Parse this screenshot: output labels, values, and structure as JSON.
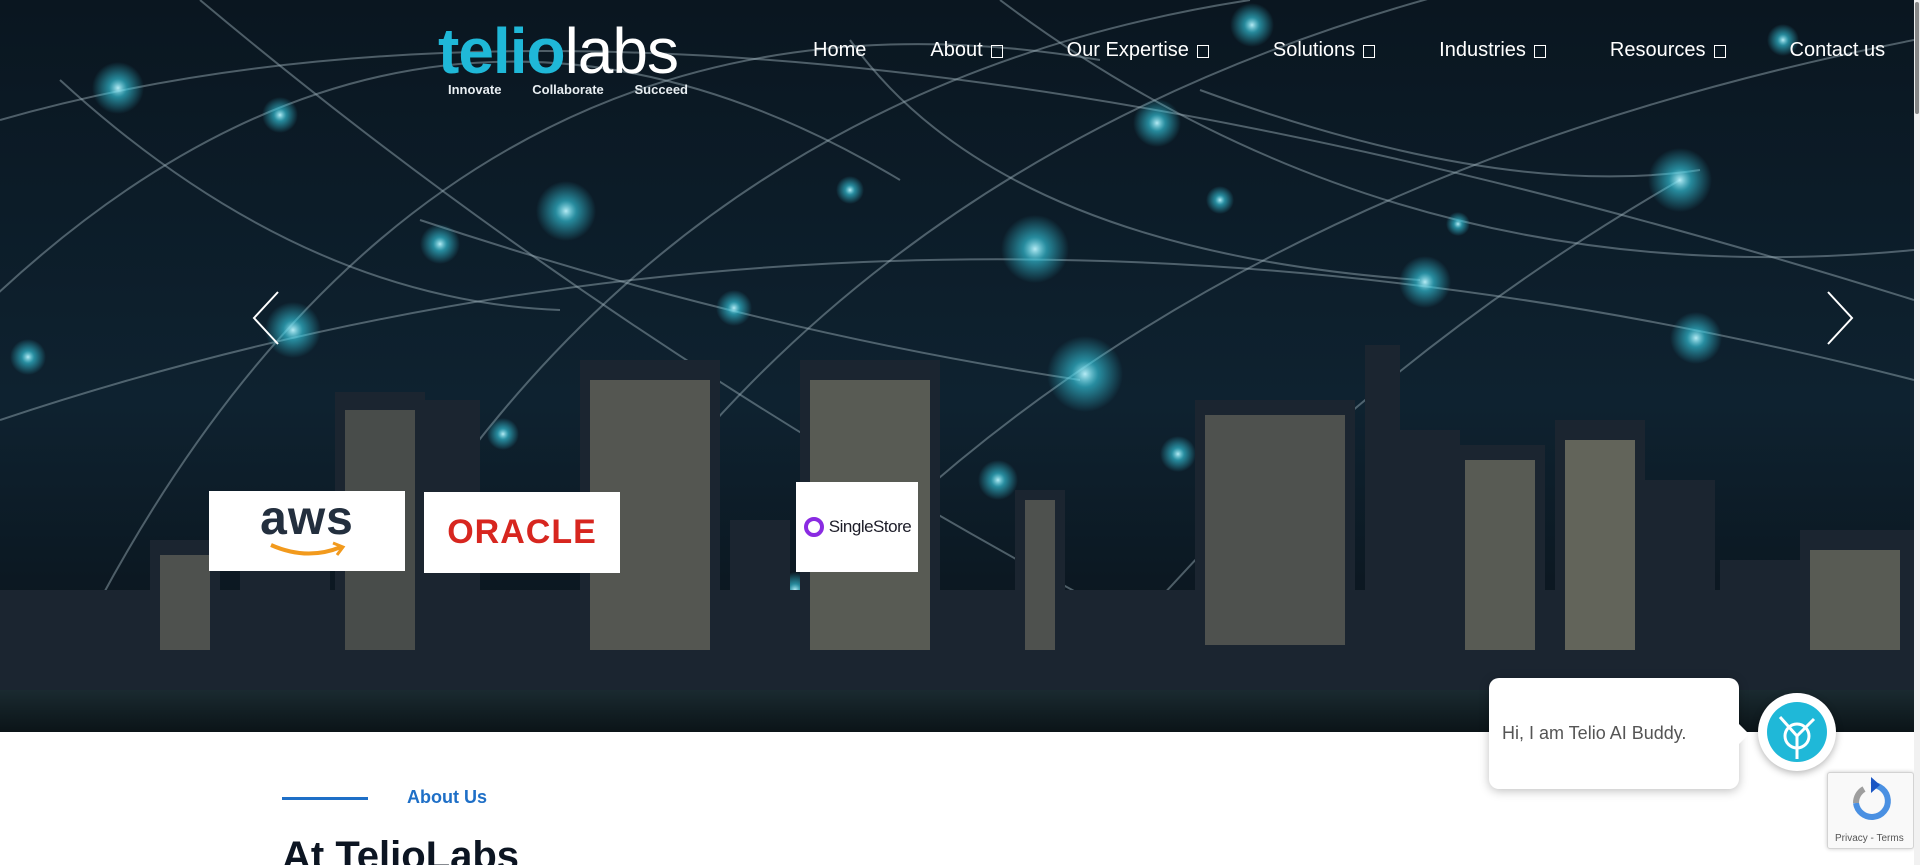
{
  "header": {
    "logo": {
      "word_part1": "telio",
      "word_part2": "labs",
      "taglines": [
        "Innovate",
        "Collaborate",
        "Succeed"
      ]
    },
    "nav": [
      {
        "label": "Home",
        "has_dropdown": false
      },
      {
        "label": "About",
        "has_dropdown": true
      },
      {
        "label": "Our Expertise",
        "has_dropdown": true
      },
      {
        "label": "Solutions",
        "has_dropdown": true
      },
      {
        "label": "Industries",
        "has_dropdown": true
      },
      {
        "label": "Resources",
        "has_dropdown": true
      },
      {
        "label": "Contact us",
        "has_dropdown": false
      }
    ]
  },
  "hero": {
    "partners": [
      {
        "name": "aws",
        "icon": "aws-logo"
      },
      {
        "name": "ORACLE",
        "icon": "oracle-logo"
      },
      {
        "name": "SingleStore",
        "icon": "singlestore-logo"
      }
    ],
    "prev_icon": "chevron-left-icon",
    "next_icon": "chevron-right-icon"
  },
  "about": {
    "eyebrow": "About Us",
    "heading": "At TelioLabs"
  },
  "chat": {
    "message": "Hi, I am Telio AI Buddy."
  },
  "recaptcha": {
    "links": "Privacy - Terms"
  },
  "colors": {
    "brand_cyan": "#1fb8d8",
    "accent_blue": "#1e6fc7",
    "oracle_red": "#d7261f",
    "hero_dark": "#0d1b2a"
  }
}
